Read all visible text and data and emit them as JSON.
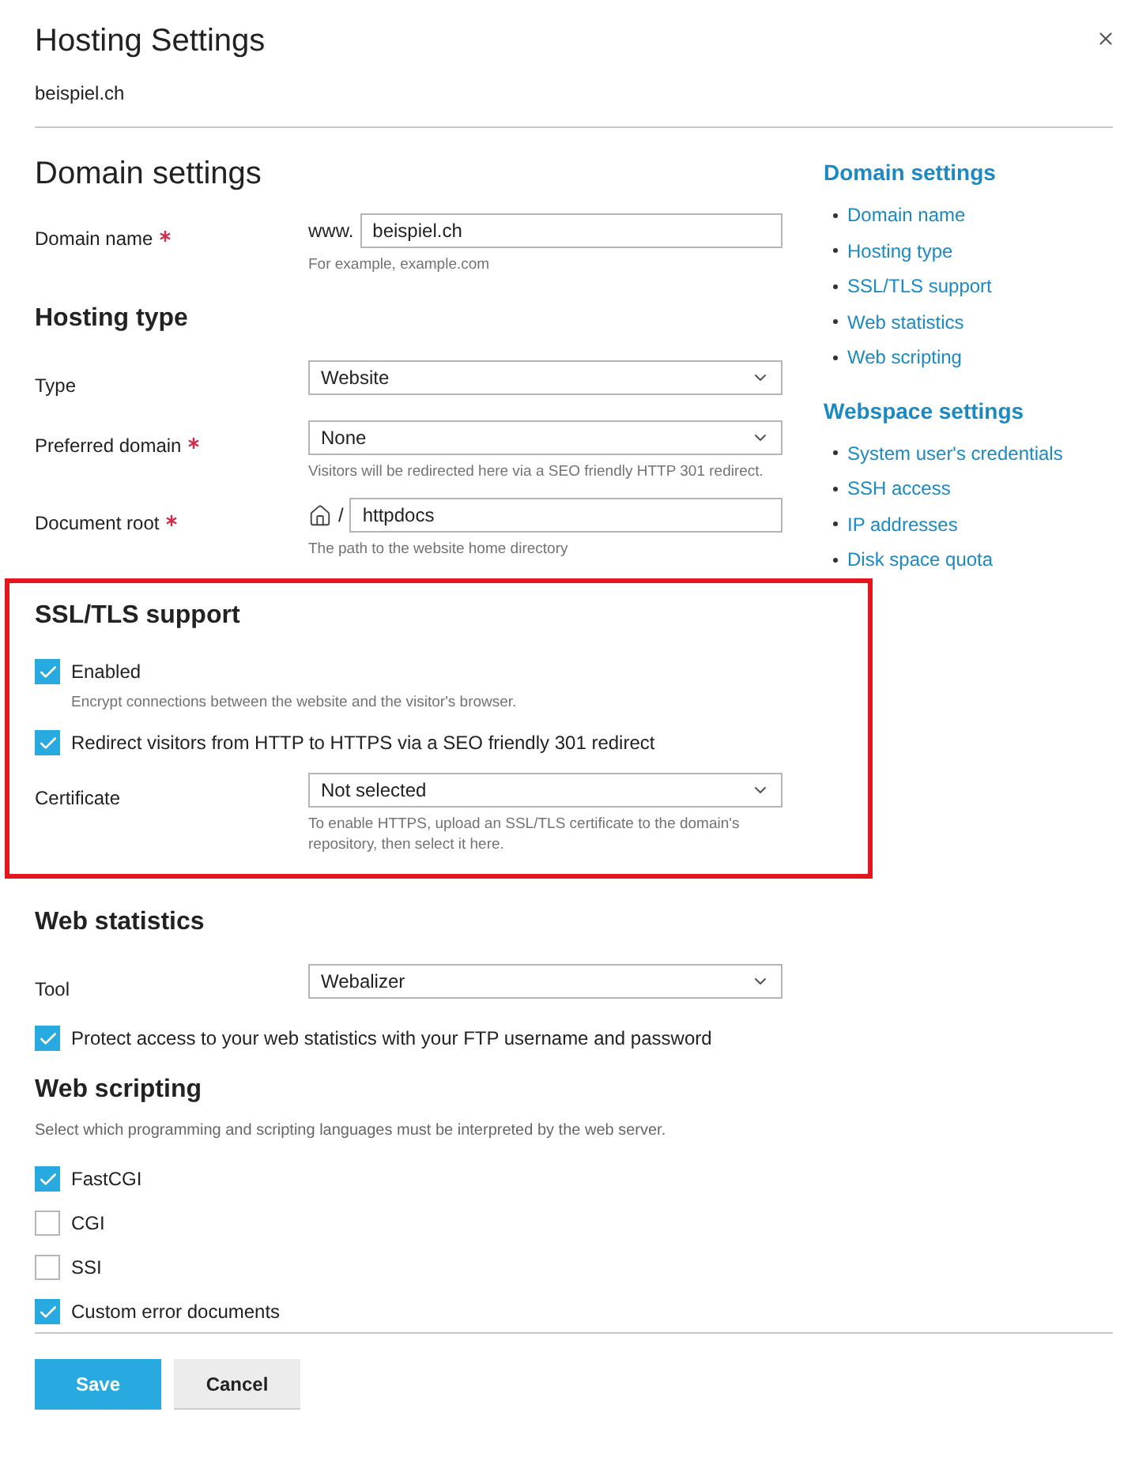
{
  "dialog": {
    "title": "Hosting Settings",
    "subtitle": "beispiel.ch"
  },
  "sections": [
    {
      "kind": "page",
      "title": "Domain settings",
      "highlighted": false,
      "fields": [
        {
          "kind": "prefixed_text",
          "label": "Domain name",
          "required": true,
          "prefix": "www.",
          "value": "beispiel.ch",
          "hint": "For example, example.com"
        }
      ]
    },
    {
      "kind": "group",
      "title": "Hosting type",
      "highlighted": false,
      "fields": [
        {
          "kind": "select",
          "label": "Type",
          "required": false,
          "value": "Website"
        },
        {
          "kind": "select",
          "label": "Preferred domain",
          "required": true,
          "value": "None",
          "hint": "Visitors will be redirected here via a SEO friendly HTTP 301 redirect."
        },
        {
          "kind": "path",
          "label": "Document root",
          "required": true,
          "prefix": "/",
          "value": "httpdocs",
          "hint": "The path to the website home directory"
        }
      ]
    },
    {
      "kind": "group",
      "title": "SSL/TLS support",
      "highlighted": true,
      "fields": [
        {
          "kind": "checkbox",
          "label": "Enabled",
          "checked": true,
          "hint": "Encrypt connections between the website and the visitor's browser."
        },
        {
          "kind": "checkbox",
          "label": "Redirect visitors from HTTP to HTTPS via a SEO friendly 301 redirect",
          "checked": true
        },
        {
          "kind": "select",
          "label": "Certificate",
          "required": false,
          "value": "Not selected",
          "hint": "To enable HTTPS, upload an SSL/TLS certificate to the domain's repository, then select it here."
        }
      ]
    },
    {
      "kind": "group",
      "title": "Web statistics",
      "highlighted": false,
      "fields": [
        {
          "kind": "select",
          "label": "Tool",
          "required": false,
          "value": "Webalizer"
        },
        {
          "kind": "checkbox",
          "label": "Protect access to your web statistics with your FTP username and password",
          "checked": true
        }
      ]
    },
    {
      "kind": "group",
      "title": "Web scripting",
      "highlighted": false,
      "description": "Select which programming and scripting languages must be interpreted by the web server.",
      "fields": [
        {
          "kind": "checkbox",
          "label": "FastCGI",
          "checked": true
        },
        {
          "kind": "checkbox",
          "label": "CGI",
          "checked": false
        },
        {
          "kind": "checkbox",
          "label": "SSI",
          "checked": false
        },
        {
          "kind": "checkbox",
          "label": "Custom error documents",
          "checked": true
        }
      ]
    }
  ],
  "nav": [
    {
      "title": "Domain settings",
      "items": [
        "Domain name",
        "Hosting type",
        "SSL/TLS support",
        "Web statistics",
        "Web scripting"
      ]
    },
    {
      "title": "Webspace settings",
      "items": [
        "System user's credentials",
        "SSH access",
        "IP addresses",
        "Disk space quota"
      ]
    }
  ],
  "buttons": [
    {
      "label": "Save",
      "kind": "primary"
    },
    {
      "label": "Cancel",
      "kind": "secondary"
    }
  ]
}
